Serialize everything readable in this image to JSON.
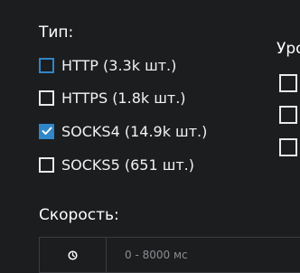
{
  "filters": {
    "type": {
      "title": "Тип:",
      "options": [
        {
          "label": "HTTP (3.3k шт.)",
          "checked": false,
          "focused": true
        },
        {
          "label": "HTTPS (1.8k шт.)",
          "checked": false,
          "focused": false
        },
        {
          "label": "SOCKS4 (14.9k шт.)",
          "checked": true,
          "focused": false
        },
        {
          "label": "SOCKS5 (651 шт.)",
          "checked": false,
          "focused": false
        }
      ]
    },
    "level": {
      "title": "Уро",
      "options": [
        {
          "checked": false
        },
        {
          "checked": false
        },
        {
          "checked": false
        }
      ]
    },
    "speed": {
      "title": "Скорость:",
      "placeholder": "0 - 8000 мс",
      "icon": "clock-icon"
    }
  },
  "colors": {
    "background": "#1c1d1f",
    "accent": "#2f86c9",
    "checkbox_border": "#e9e9e9",
    "text": "#f2f2f2",
    "muted": "#8b8d91",
    "input_border": "#3a3c40"
  }
}
